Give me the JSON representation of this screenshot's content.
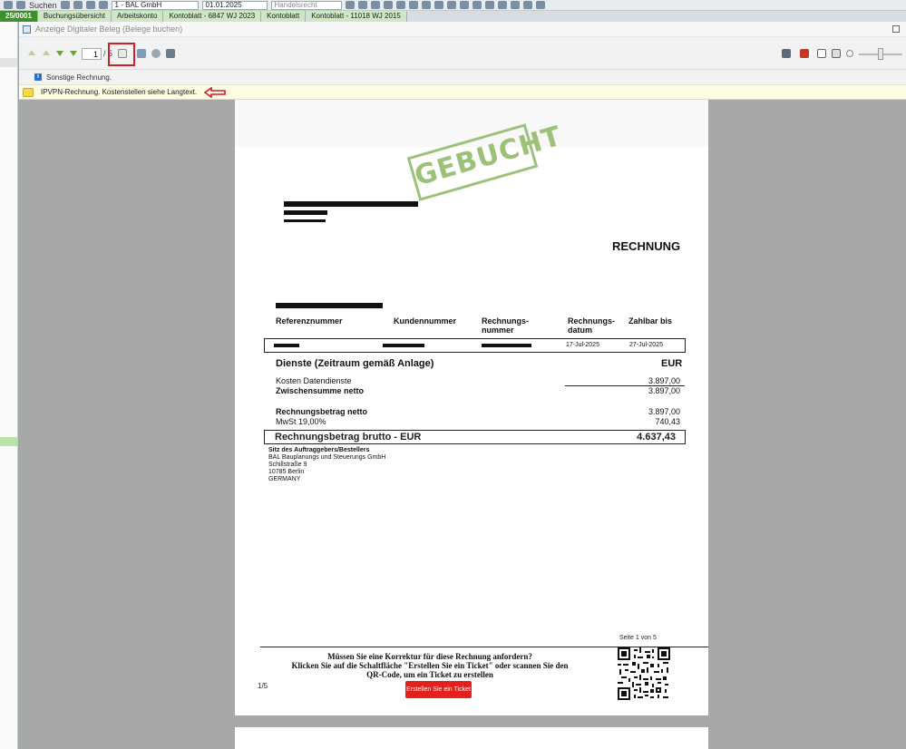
{
  "background_app": {
    "toolbar": {
      "search_label": "Suchen",
      "company_select": "1 - BAL GmbH",
      "date_select": "01.01.2025",
      "law_select": "Handelsrecht"
    },
    "tabs": [
      {
        "label": "25/0001"
      },
      {
        "label": "Buchungsübersicht"
      },
      {
        "label": "Arbeitskonto"
      },
      {
        "label": "Kontoblatt - 6847 WJ 2023"
      },
      {
        "label": "Kontoblatt"
      },
      {
        "label": "Kontoblatt - 11018 WJ 2015"
      }
    ]
  },
  "dialog": {
    "title": "Anzeige Digitaler Beleg (Belege buchen)",
    "toolbar": {
      "page_current": "1",
      "page_total": "/ 5"
    },
    "info_text": "Sonstige Rechnung.",
    "note_text": "IPVPN-Rechnung. Kostenstellen siehe Langtext."
  },
  "document": {
    "stamp": "GEBUCHT",
    "title": "RECHNUNG",
    "columns": [
      {
        "label": "Referenznummer"
      },
      {
        "label": "Kundennummer"
      },
      {
        "label": "Rechnungs-\nnummer"
      },
      {
        "label": "Rechnungs-\ndatum"
      },
      {
        "label": "Zahlbar bis"
      }
    ],
    "invoice_date": "17-Jul-2025",
    "due_date": "27-Jul-2025",
    "section_title": "Dienste (Zeitraum gemäß Anlage)",
    "currency": "EUR",
    "lines": {
      "costs_label": "Kosten Datendienste",
      "costs_value": "3.897,00",
      "subtotal_label": "Zwischensumme netto",
      "subtotal_value": "3.897,00",
      "net_label": "Rechnungsbetrag netto",
      "net_value": "3.897,00",
      "vat_label": "MwSt  19,00%",
      "vat_value": "740,43",
      "gross_label": "Rechnungsbetrag brutto - EUR",
      "gross_value": "4.637,43"
    },
    "address": {
      "heading": "Sitz des Auftraggebers/Bestellers",
      "line1": "BAL Bauplanungs und Steuerungs GmbH",
      "line2": "Schillstraße 9",
      "line3": "10785 Berlin",
      "line4": "GERMANY"
    },
    "page_label": "Seite 1 von 5",
    "footer": {
      "line1": "Müssen Sie eine Korrektur für diese Rechnung anfordern?",
      "line2": "Klicken Sie auf die Schaltfläche \"Erstellen Sie ein Ticket\" oder scannen Sie den",
      "line3": "QR-Code, um ein Ticket zu erstellen",
      "pages": "1/5",
      "button": "Erstellen Sie ein Ticket"
    }
  },
  "colors": {
    "highlight_red": "#d0202a",
    "stamp_green": "#9cc27a",
    "ticket_red": "#e3201b",
    "note_yellow": "#fdfbe1"
  }
}
